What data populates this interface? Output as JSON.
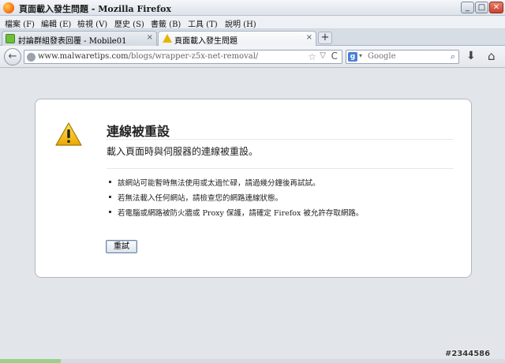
{
  "window": {
    "title": "頁面載入發生問題 - Mozilla Firefox",
    "minimize": "_",
    "maximize": "□",
    "close": "✕"
  },
  "menu": [
    "檔案 (F)",
    "編輯 (E)",
    "檢視 (V)",
    "歷史 (S)",
    "書籤 (B)",
    "工具 (T)",
    "說明 (H)"
  ],
  "tabs": [
    {
      "label": "討論群組發表回覆 - Mobile01",
      "close": "×",
      "icon": "forum-favicon"
    },
    {
      "label": "頁面載入發生問題",
      "close": "×",
      "icon": "warning-icon"
    }
  ],
  "new_tab": "+",
  "nav": {
    "back": "←",
    "url_domain": "www.malwaretips.com",
    "url_path": "/blogs/wrapper-z5x-net-removal/",
    "star": "☆",
    "dropdown": "▽",
    "reload": "C",
    "search_engine_icon": "g",
    "search_placeholder": "Google",
    "search_go": "⌕",
    "download": "⬇",
    "home": "⌂"
  },
  "error": {
    "title": "連線被重設",
    "subtitle": "載入頁面時與伺服器的連線被重設。",
    "items": [
      "該網站可能暫時無法使用或太過忙碌，請過幾分鐘後再試試。",
      "若無法載入任何網站，請檢查您的網路連線狀態。",
      "若電腦或網路被防火牆或 Proxy 保護，請確定 Firefox 被允許存取網路。"
    ],
    "retry": "重試"
  },
  "watermark": "#2344586",
  "status": {
    "progress": 0.12
  }
}
